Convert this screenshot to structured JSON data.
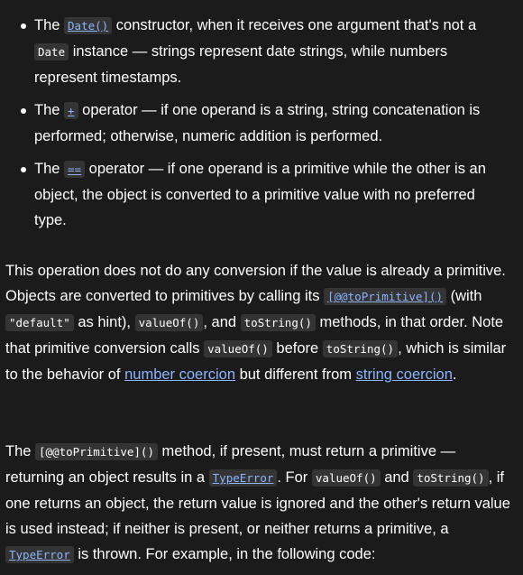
{
  "bullets": [
    {
      "t1": "The ",
      "code1": "Date()",
      "t2": " constructor, when it receives one argument that's not a ",
      "code2": "Date",
      "t3": " instance — strings represent date strings, while numbers represent timestamps."
    },
    {
      "t1": "The ",
      "code1": "+",
      "t2": " operator — if one operand is a string, string concatenation is performed; otherwise, numeric addition is performed."
    },
    {
      "t1": "The ",
      "code1": "==",
      "t2": " operator — if one operand is a primitive while the other is an object, the object is converted to a primitive value with no preferred type."
    }
  ],
  "para1": {
    "t1": "This operation does not do any conversion if the value is already a primitive. Objects are converted to primitives by calling its ",
    "code_toprimitive": "[@@toPrimitive]()",
    "t2": " (with ",
    "code_default": "\"default\"",
    "t3": " as hint), ",
    "code_valueof": "valueOf()",
    "t4": ", and ",
    "code_tostring": "toString()",
    "t5": " methods, in that order. Note that primitive conversion calls ",
    "code_valueof2": "valueOf()",
    "t6": " before ",
    "code_tostring2": "toString()",
    "t7": ", which is similar to the behavior of ",
    "link_number": "number coercion",
    "t8": " but different from ",
    "link_string": "string coercion",
    "t9": "."
  },
  "para2": {
    "t1": "The ",
    "code_toprimitive": "[@@toPrimitive]()",
    "t2": " method, if present, must return a primitive — returning an object results in a ",
    "code_typeerror": "TypeError",
    "t3": ". For ",
    "code_valueof": "valueOf()",
    "t4": " and ",
    "code_tostring": "toString()",
    "t5": ", if one returns an object, the return value is ignored and the other's return value is used instead; if neither is present, or neither returns a primitive, a ",
    "code_typeerror2": "TypeError",
    "t6": " is thrown. For example, in the following code:"
  },
  "colors": {
    "background": "#1b1b1b",
    "text": "#ffffff",
    "code_background": "#343434",
    "link": "#8cb4ff"
  }
}
